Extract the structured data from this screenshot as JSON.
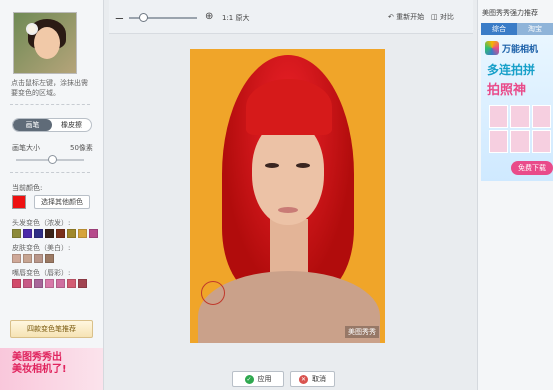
{
  "left": {
    "tip": "点击鼠标左键，涂抹出需要变色的区域。",
    "mode_tabs": [
      "画笔",
      "橡皮擦"
    ],
    "brush_size_label": "画笔大小",
    "brush_size_value": "50像素",
    "current_color_label": "当前颜色:",
    "current_color": "#ee1111",
    "pick_other_color": "选择其他颜色",
    "groups": [
      {
        "label": "头发变色（浓发）:",
        "colors": [
          "#8d8b3a",
          "#4b2aa8",
          "#2f2f86",
          "#3b2318",
          "#7a2f1a",
          "#a0882a",
          "#d6a43b",
          "#b64a8c"
        ]
      },
      {
        "label": "皮肤变色（美白）:",
        "colors": [
          "#cfa898",
          "#c7a592",
          "#b9978a",
          "#9c7a64"
        ]
      },
      {
        "label": "嘴唇变色（唇彩）:",
        "colors": [
          "#d24b6b",
          "#c75a86",
          "#a8679a",
          "#d879a9",
          "#cf6fa0",
          "#d35c73",
          "#a14451"
        ]
      }
    ],
    "promo_button": "四款变色笔推荐",
    "promo_banner_line1": "美图秀秀出",
    "promo_banner_line2": "美妆相机了!"
  },
  "toolbar": {
    "zoom_out_icon": "zoom-out-icon",
    "zoom_in_icon": "zoom-in-icon",
    "zoom_level": 0.2,
    "original_size": "1:1 原大",
    "reset": "重新开始",
    "compare": "对比"
  },
  "canvas": {
    "watermark": "美图秀秀"
  },
  "actions": {
    "apply": "应用",
    "cancel": "取消"
  },
  "right": {
    "title": "美图秀秀强力推荐",
    "tabs": [
      "综合",
      "淘宝"
    ],
    "ad_name": "万能相机",
    "ad_line1": "多连拍拼",
    "ad_line2": "拍照神",
    "ad_download": "免费下载"
  }
}
